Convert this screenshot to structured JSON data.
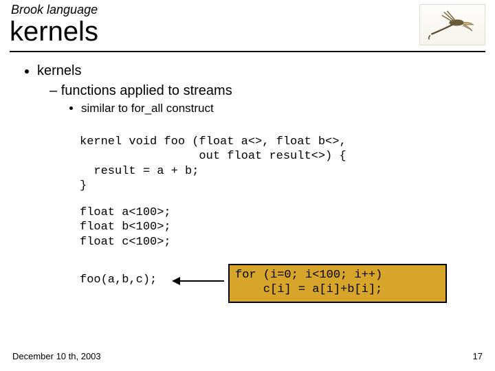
{
  "header": {
    "suptitle": "Brook language",
    "title": "kernels"
  },
  "bullets": {
    "l1": "kernels",
    "l2": "functions applied to streams",
    "l3": "similar to for_all construct"
  },
  "code": {
    "kernel_def": "kernel void foo (float a<>, float b<>,\n                 out float result<>) {\n  result = a + b;\n}",
    "decls": "float a<100>;\nfloat b<100>;\nfloat c<100>;",
    "call": "foo(a,b,c);",
    "expanded": "for (i=0; i<100; i++)\n    c[i] = a[i]+b[i];"
  },
  "footer": {
    "date": "December 10 th, 2003",
    "page": "17"
  }
}
